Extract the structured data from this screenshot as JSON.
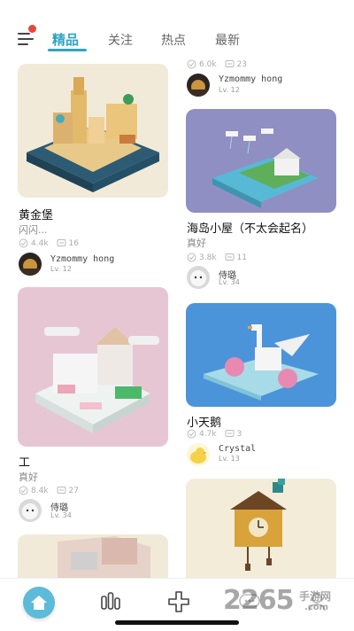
{
  "nav": {
    "tabs": [
      {
        "label": "精品"
      },
      {
        "label": "关注"
      },
      {
        "label": "热点"
      },
      {
        "label": "最新"
      }
    ],
    "active_tab": "精品"
  },
  "left_column": [
    {
      "title": "黄金堡",
      "subtitle": "闪闪...",
      "likes": "4.4k",
      "comments": "16",
      "user": {
        "name": "Yzmommy hong",
        "level": "Lv. 12"
      }
    },
    {
      "title": "工",
      "subtitle": "真好",
      "likes": "8.4k",
      "comments": "27",
      "user": {
        "name": "侍璐",
        "level": "Lv. 34"
      }
    }
  ],
  "right_column": [
    {
      "likes": "6.0k",
      "comments": "23",
      "user": {
        "name": "Yzmommy hong",
        "level": "Lv. 12"
      }
    },
    {
      "title": "海岛小屋（不太会起名）",
      "subtitle": "真好",
      "likes": "3.8k",
      "comments": "11",
      "user": {
        "name": "侍璐",
        "level": "Lv. 34"
      }
    },
    {
      "title": "小天鹅",
      "likes": "4.7k",
      "comments": "3",
      "user": {
        "name": "Crystal",
        "level": "Lv. 13"
      }
    }
  ],
  "bottom_bar": {
    "items": [
      "home-icon",
      "stats-icon",
      "add-icon",
      "message-icon",
      "profile-icon"
    ]
  },
  "watermark": {
    "text": "2265",
    "suffix": "手游网",
    "domain": ".com"
  },
  "colors": {
    "accent": "#2fa4c4",
    "home_bubble": "#5bbbd8"
  }
}
